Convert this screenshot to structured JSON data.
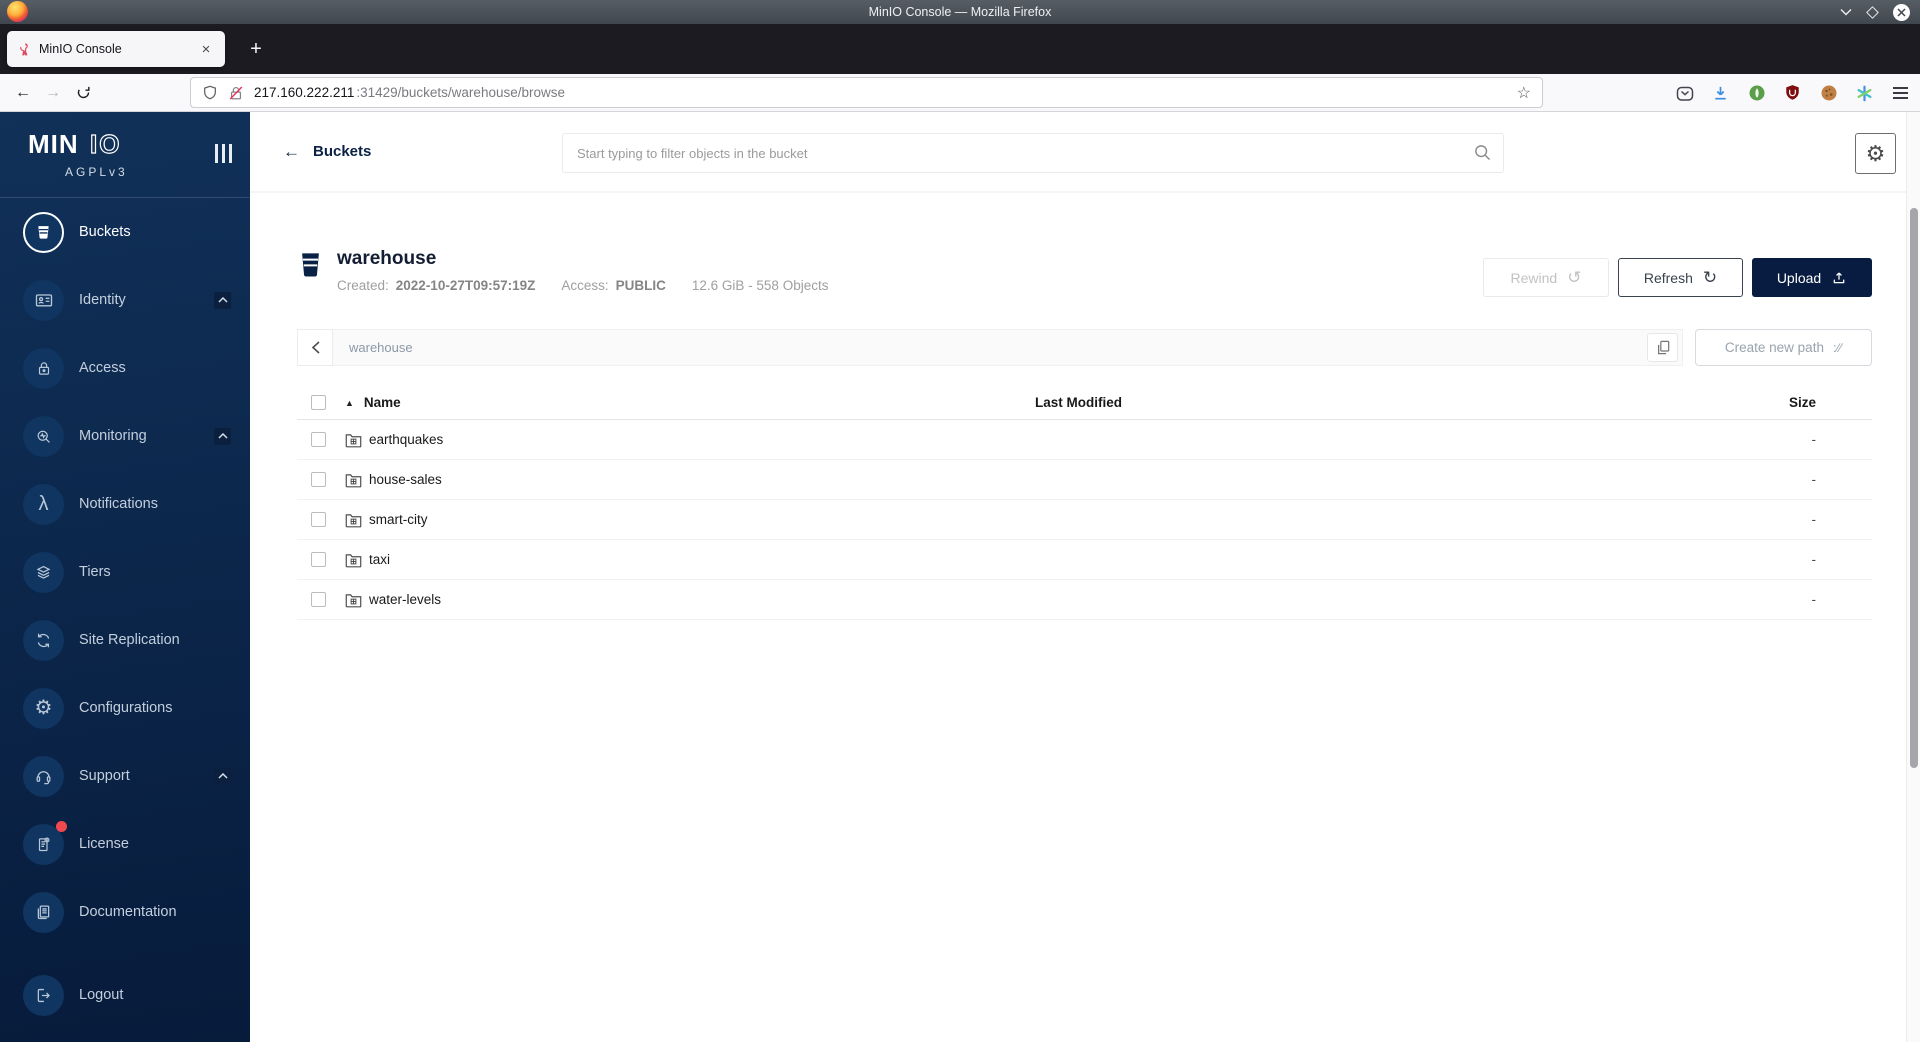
{
  "browser": {
    "window_title": "MinIO Console — Mozilla Firefox",
    "tab": {
      "title": "MinIO Console",
      "close_label": "×",
      "new_tab_label": "+"
    },
    "nav": {
      "back": "←",
      "forward": "→"
    },
    "url": {
      "host": "217.160.222.211",
      "rest": ":31429/buckets/warehouse/browse",
      "star": "☆"
    }
  },
  "sidebar": {
    "logo_min": "MIN",
    "logo_io": "IO",
    "license_tier": "AGPLv3",
    "items": [
      {
        "label": "Buckets"
      },
      {
        "label": "Identity"
      },
      {
        "label": "Access"
      },
      {
        "label": "Monitoring"
      },
      {
        "label": "Notifications"
      },
      {
        "label": "Tiers"
      },
      {
        "label": "Site Replication"
      },
      {
        "label": "Configurations"
      },
      {
        "label": "Support"
      },
      {
        "label": "License"
      },
      {
        "label": "Documentation"
      },
      {
        "label": "Logout"
      }
    ],
    "lambda_glyph": "λ",
    "gear_glyph": "⚙"
  },
  "header": {
    "back_label": "Buckets",
    "back_arrow": "←",
    "search_placeholder": "Start typing to filter objects in the bucket",
    "gear_glyph": "⚙"
  },
  "bucket": {
    "name": "warehouse",
    "created_label": "Created:",
    "created_value": "2022-10-27T09:57:19Z",
    "access_label": "Access:",
    "access_value": "PUBLIC",
    "usage": "12.6 GiB - 558 Objects",
    "actions": {
      "rewind": "Rewind",
      "rewind_glyph": "↺",
      "refresh": "Refresh",
      "refresh_glyph": "↻",
      "upload": "Upload"
    }
  },
  "pathbar": {
    "current_path": "warehouse",
    "create_new_path": "Create new path",
    "create_icon_text": ":∕∕"
  },
  "table": {
    "headers": {
      "name": "Name",
      "last_modified": "Last Modified",
      "size": "Size",
      "sort_glyph": "▲"
    },
    "rows": [
      {
        "name": "earthquakes",
        "size": "-"
      },
      {
        "name": "house-sales",
        "size": "-"
      },
      {
        "name": "smart-city",
        "size": "-"
      },
      {
        "name": "taxi",
        "size": "-"
      },
      {
        "name": "water-levels",
        "size": "-"
      }
    ]
  },
  "colors": {
    "accent_navy": "#081c42",
    "sidebar_gradient_top": "#113159",
    "sidebar_gradient_bottom": "#071b3b",
    "badge_red": "#f0484f",
    "download_blue": "#3a8fe0",
    "ublock_red": "#7e0e10"
  }
}
